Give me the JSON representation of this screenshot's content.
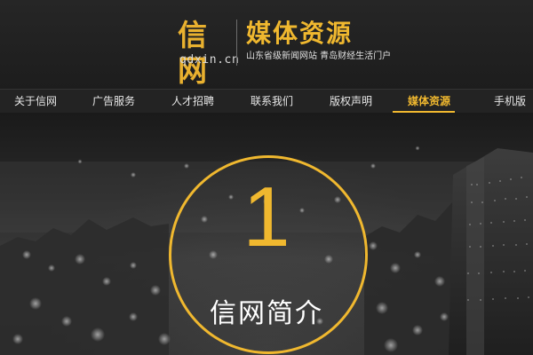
{
  "header": {
    "logo_text": "信网",
    "logo_domain": "qdxin.cn",
    "title": "媒体资源",
    "tagline": "山东省级新闻网站  青岛财经生活门户"
  },
  "nav": {
    "items": [
      {
        "label": "关于信网"
      },
      {
        "label": "广告服务"
      },
      {
        "label": "人才招聘"
      },
      {
        "label": "联系我们"
      },
      {
        "label": "版权声明"
      },
      {
        "label": "媒体资源",
        "active": true
      },
      {
        "label": "手机版"
      }
    ]
  },
  "hero": {
    "number": "1",
    "section_title": "信网简介"
  },
  "colors": {
    "accent": "#f0b82f",
    "background": "#161616",
    "nav_text": "#e8e8e8"
  }
}
